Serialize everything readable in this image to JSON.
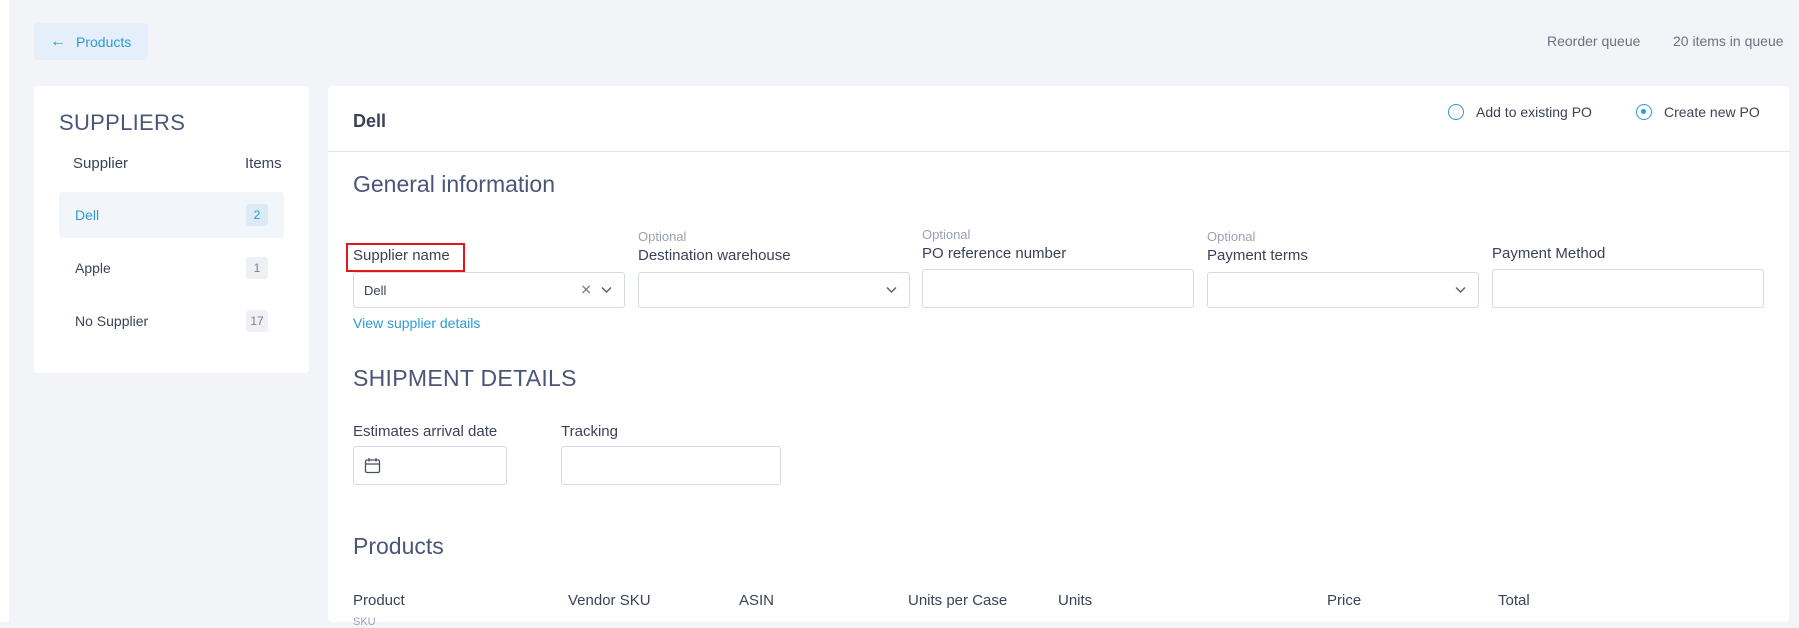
{
  "header": {
    "back_label": "Products",
    "reorder_queue": "Reorder queue",
    "queue_count": "20 items in queue"
  },
  "suppliers": {
    "title": "SUPPLIERS",
    "col_supplier": "Supplier",
    "col_items": "Items",
    "rows": [
      {
        "name": "Dell",
        "count": "2",
        "active": true
      },
      {
        "name": "Apple",
        "count": "1",
        "active": false
      },
      {
        "name": "No Supplier",
        "count": "17",
        "active": false
      }
    ]
  },
  "main": {
    "title": "Dell",
    "radio_existing": "Add to existing PO",
    "radio_new": "Create new PO",
    "radio_selected": "Create new PO",
    "general": {
      "heading": "General information",
      "supplier_label": "Supplier name",
      "supplier_value": "Dell",
      "dest_optional": "Optional",
      "dest_label": "Destination warehouse",
      "po_optional": "Optional",
      "po_label": "PO reference number",
      "terms_optional": "Optional",
      "terms_label": "Payment terms",
      "method_label": "Payment Method",
      "view_details": "View supplier details"
    },
    "shipment": {
      "heading": "SHIPMENT DETAILS",
      "arrival_label": "Estimates arrival date",
      "tracking_label": "Tracking"
    },
    "products": {
      "heading": "Products",
      "columns": [
        "Product",
        "Vendor SKU",
        "ASIN",
        "Units per Case",
        "Units",
        "Price",
        "Total"
      ],
      "product_sub": "SKU"
    }
  },
  "colors": {
    "accent": "#2b9ad6",
    "highlight": "#e3161b",
    "heading": "#4a5578"
  }
}
